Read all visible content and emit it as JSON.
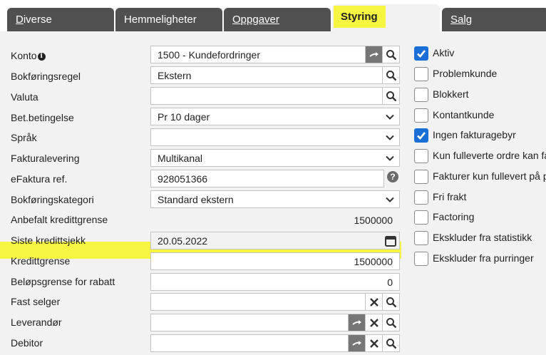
{
  "tabs": [
    {
      "label_u": "D",
      "label_rest": "iverse",
      "active": false
    },
    {
      "label_u": "",
      "label_rest": "Hemmeligheter",
      "active": false
    },
    {
      "label_u": "O",
      "label_rest": "ppgaver",
      "active": false
    },
    {
      "label_u": "",
      "label_rest": "Styring",
      "active": true
    },
    {
      "label_u": "S",
      "label_rest": "alg",
      "active": false
    }
  ],
  "labels": {
    "konto": "Konto",
    "bokforingsregel": "Bokføringsregel",
    "valuta": "Valuta",
    "betbetingelse": "Bet.betingelse",
    "sprak": "Språk",
    "fakturalevering": "Fakturalevering",
    "efaktura": "eFaktura ref.",
    "bokforingskategori": "Bokføringskategori",
    "anbefalt": "Anbefalt kredittgrense",
    "siste": "Siste kredittsjekk",
    "kredittgrense": "Kredittgrense",
    "belopsgrense": "Beløpsgrense for rabatt",
    "fastselger": "Fast selger",
    "leverandor": "Leverandør",
    "debitor": "Debitor"
  },
  "values": {
    "konto": "1500 - Kundefordringer",
    "bokforingsregel": "Ekstern",
    "valuta": "",
    "betbetingelse": "Pr 10 dager",
    "sprak": "",
    "fakturalevering": "Multikanal",
    "efaktura": "928051366",
    "bokforingskategori": "Standard ekstern",
    "anbefalt": "1500000",
    "siste": "20.05.2022",
    "kredittgrense": "1500000",
    "belopsgrense": "0",
    "fastselger": "",
    "leverandor": "",
    "debitor": ""
  },
  "checkboxes": [
    {
      "label": "Aktiv",
      "checked": true
    },
    {
      "label": "Problemkunde",
      "checked": false
    },
    {
      "label": "Blokkert",
      "checked": false
    },
    {
      "label": "Kontantkunde",
      "checked": false
    },
    {
      "label": "Ingen fakturagebyr",
      "checked": true
    },
    {
      "label": "Kun fulleverte ordre kan fa",
      "checked": false
    },
    {
      "label": "Fakturer kun fullevert på p",
      "checked": false
    },
    {
      "label": "Fri frakt",
      "checked": false
    },
    {
      "label": "Factoring",
      "checked": false
    },
    {
      "label": "Ekskluder fra statistikk",
      "checked": false
    },
    {
      "label": "Ekskluder fra purringer",
      "checked": false
    }
  ],
  "glyphs": {
    "info": "i",
    "help": "?"
  },
  "icons": {
    "goto": "arrow-right-icon",
    "search": "search-icon",
    "clear": "close-icon",
    "calendar": "calendar-icon",
    "dropdown": "chevron-down-icon",
    "check": "checkmark-icon"
  },
  "colors": {
    "tab_bg": "#505050",
    "highlight": "#f5f542",
    "icon_button": "#767676",
    "checkbox_on": "#1a6fd6"
  }
}
